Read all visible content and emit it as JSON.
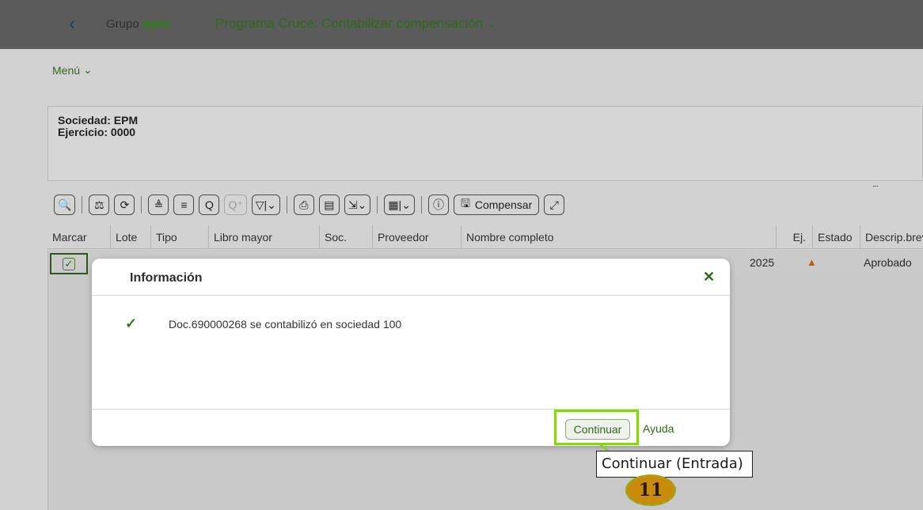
{
  "shell": {
    "back_icon": "chevron-left-icon",
    "logo_prefix": "Grupo",
    "logo_brand": "epm",
    "app_title": "Programa Cruce: Contabilizar compensación"
  },
  "menu": {
    "label": "Menú"
  },
  "header": {
    "sociedad": "Sociedad: EPM",
    "ejercicio": "Ejercicio: 0000"
  },
  "toolbar": {
    "compensar_label": "Compensar"
  },
  "table": {
    "columns": [
      "Marcar",
      "Lote",
      "Tipo",
      "Libro mayor",
      "Soc.",
      "Proveedor",
      "Nombre completo",
      "Ej.",
      "Estado",
      "Descrip.breve"
    ],
    "rows": [
      {
        "ej": "2025",
        "estado_icon": "warning-triangle-icon",
        "descrip": "Aprobado"
      }
    ]
  },
  "dialog": {
    "title": "Información",
    "message": "Doc.690000268 se contabilizó en sociedad 100",
    "continue_label": "Continuar",
    "help_label": "Ayuda"
  },
  "tooltip": {
    "text": "Continuar (Entrada)"
  },
  "annotation": {
    "step": "11"
  },
  "colors": {
    "accent": "#2e6a1a",
    "highlight": "#8bd21e",
    "badge": "#c98b0c"
  }
}
